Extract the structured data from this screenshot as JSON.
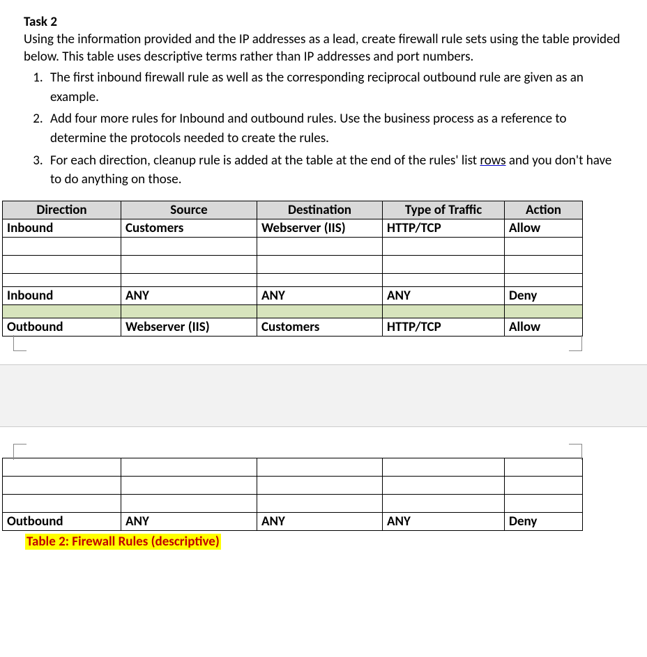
{
  "task": {
    "title": "Task 2",
    "intro": "Using the information provided and the IP addresses as a lead, create firewall rule sets using the table provided below.  This table uses descriptive terms rather than IP addresses and port numbers.",
    "items": [
      "The first inbound firewall rule as well as the corresponding reciprocal outbound rule are given as an example.",
      "Add four more rules for Inbound and outbound rules. Use the business process as a reference to determine the protocols needed to create the rules.",
      "For each direction, cleanup rule is added at the table at the end of the rules' list rows and you don't have to do anything on those."
    ],
    "rows_word": "rows"
  },
  "headers": {
    "direction": "Direction",
    "source": "Source",
    "destination": "Destination",
    "traffic": "Type of Traffic",
    "action": "Action"
  },
  "table1": {
    "row0": {
      "direction": "Inbound",
      "source": "Customers",
      "destination": "Webserver (IIS)",
      "traffic": "HTTP/TCP",
      "action": "Allow"
    },
    "row_cleanup_in": {
      "direction": "Inbound",
      "source": "ANY",
      "destination": "ANY",
      "traffic": "ANY",
      "action": "Deny"
    },
    "row_out0": {
      "direction": "Outbound",
      "source": "Webserver (IIS)",
      "destination": "Customers",
      "traffic": "HTTP/TCP",
      "action": "Allow"
    }
  },
  "table2": {
    "row_cleanup_out": {
      "direction": "Outbound",
      "source": "ANY",
      "destination": "ANY",
      "traffic": "ANY",
      "action": "Deny"
    }
  },
  "caption": "Table 2: Firewall Rules (descriptive)"
}
